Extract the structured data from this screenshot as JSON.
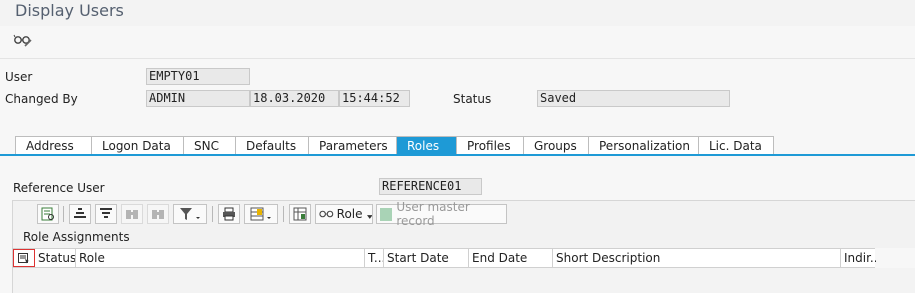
{
  "window": {
    "title": "Display Users"
  },
  "toolbar": {
    "other_icon": "glasses-pencil-icon"
  },
  "form": {
    "user_label": "User",
    "user_value": "EMPTY01",
    "changed_by_label": "Changed By",
    "changed_by_value": "ADMIN",
    "changed_date": "18.03.2020",
    "changed_time": "15:44:52",
    "status_label": "Status",
    "status_value": "Saved"
  },
  "tabs": [
    {
      "label": "Address"
    },
    {
      "label": "Logon Data"
    },
    {
      "label": "SNC"
    },
    {
      "label": "Defaults"
    },
    {
      "label": "Parameters"
    },
    {
      "label": "Roles",
      "active": true
    },
    {
      "label": "Profiles"
    },
    {
      "label": "Groups"
    },
    {
      "label": "Personalization"
    },
    {
      "label": "Lic. Data"
    }
  ],
  "reference": {
    "label": "Reference User",
    "value": "REFERENCE01"
  },
  "alv_toolbar": {
    "role_button": "Role",
    "user_master_button": "User master record"
  },
  "table": {
    "title": "Role Assignments",
    "columns": [
      "Status",
      "Role",
      "T...",
      "Start Date",
      "End Date",
      "Short Description",
      "Indir..."
    ]
  },
  "colors": {
    "accent": "#1e9ad6",
    "title": "#556070"
  }
}
